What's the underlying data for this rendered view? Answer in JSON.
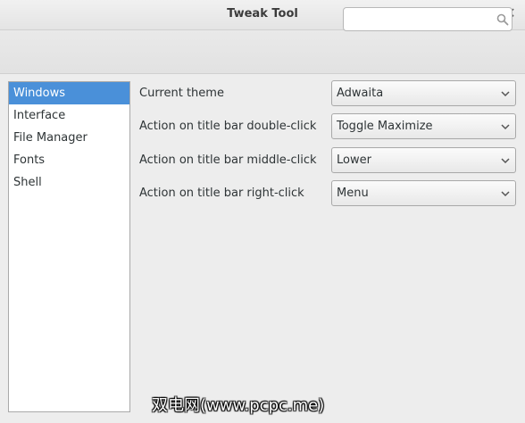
{
  "window": {
    "title": "Tweak Tool"
  },
  "search": {
    "value": "",
    "placeholder": ""
  },
  "sidebar": {
    "items": [
      {
        "label": "Windows",
        "selected": true
      },
      {
        "label": "Interface",
        "selected": false
      },
      {
        "label": "File Manager",
        "selected": false
      },
      {
        "label": "Fonts",
        "selected": false
      },
      {
        "label": "Shell",
        "selected": false
      }
    ]
  },
  "settings": [
    {
      "label": "Current theme",
      "value": "Adwaita"
    },
    {
      "label": "Action on title bar double-click",
      "value": "Toggle Maximize"
    },
    {
      "label": "Action on title bar middle-click",
      "value": "Lower"
    },
    {
      "label": "Action on title bar right-click",
      "value": "Menu"
    }
  ],
  "watermark": {
    "text": "双电网(www.pcpc.me)"
  },
  "colors": {
    "selection": "#4a90d9",
    "selection_text": "#ffffff",
    "window_bg": "#ededed"
  },
  "icons": {
    "close": "close-icon",
    "search": "search-icon",
    "dropdown": "chevron-down-icon"
  }
}
